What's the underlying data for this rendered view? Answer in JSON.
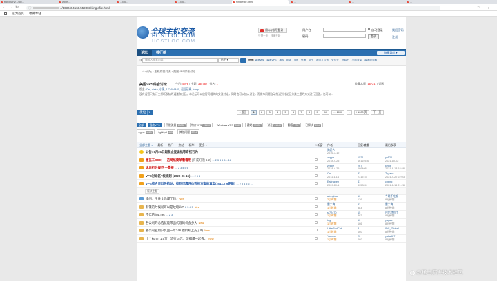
{
  "browser": {
    "tabs": [
      {
        "label": "thirdparty.../loc..."
      },
      {
        "label": "Apps..."
      },
      {
        "label": "...loc..."
      },
      {
        "label": "...loc..."
      },
      {
        "label": "singlefile.html"
      },
      {
        "label": "..."
      },
      {
        "label": "..."
      },
      {
        "label": "..."
      }
    ],
    "url_suffix": "../1632494168.552303/singlefile.html",
    "bookmarks": [
      "设为首页",
      "收藏本站"
    ]
  },
  "site": {
    "logo_cn": "全球主机交流",
    "logo_en": "HOSTLOC.COM",
    "qq_login": "用QQ帐号登录",
    "qq_sub": "只需一步，快速开始",
    "login": {
      "user_label": "用户名",
      "pass_label": "密码",
      "remember": "自动登录",
      "forgot": "找回密码",
      "login_btn": "登录",
      "register": "注册"
    },
    "nav": [
      {
        "label": "论坛"
      },
      {
        "label": "排行榜"
      }
    ],
    "quick_nav": "快捷导航 ▾",
    "search": {
      "placeholder": "请输入搜索内容",
      "scope": "帖子 ▾",
      "hot_label": "热搜:",
      "hot": [
        "香港vps",
        "香港VPS",
        "aws",
        "机场",
        "vps",
        "分销",
        "VPS",
        "搬瓦工公司",
        "火车头",
        "近似石",
        "不限流量",
        "香港服务器"
      ]
    },
    "breadcrumb": "⌂  ›  论坛  ›  主机综合交流  ›  美国VPS综合讨论"
  },
  "forum": {
    "title": "美国VPS综合讨论",
    "stats": [
      "今日:",
      "5976",
      "|",
      "主题:",
      "785782",
      "|",
      "排名:",
      "1"
    ],
    "favorite": "收藏本版 (",
    "favorite_count": "16721",
    "favorite_end": ")",
    "subscribe": "订阅",
    "moderators_label": "版主:",
    "moderators": "Cat, claire, 小黑, 177404A05, 逗逗莅棒, tomp",
    "rule": "没有运营只有订主打断发帖的通道和社区。本论坛可以放官司相关的交流讨论，同时也可以加入讨论，而发布问题自动推送到讨论区分类主题的方式进行回答，也可以..."
  },
  "pager": {
    "publish": "发帖",
    "prev": "< 返回",
    "pages": [
      "1",
      "2",
      "3",
      "4",
      "5",
      "6",
      "7",
      "8",
      "9",
      "10",
      "... 1000",
      "›",
      "/ 1000 页",
      "下一页"
    ]
  },
  "tags": [
    {
      "label": "全部",
      "count": "",
      "on": true
    },
    {
      "label": "温故VPS",
      "count": "",
      "on": true
    },
    {
      "label": "不限流量",
      "count": "18082"
    },
    {
      "label": "特价VPS",
      "count": "21150"
    },
    {
      "label": "Windows VPS",
      "count": "2285"
    },
    {
      "label": "建站",
      "count": "39392"
    },
    {
      "label": "讨论",
      "count": "41548"
    },
    {
      "label": "翻墙",
      "count": "292"
    },
    {
      "label": "已解决",
      "count": "3016"
    },
    {
      "label": "eginx",
      "count": "1923"
    },
    {
      "label": "lighttpd",
      "count": "465"
    },
    {
      "label": "其他问题",
      "count": "2754"
    }
  ],
  "list_header": {
    "filters": [
      "全部主题 ▾",
      "最新",
      "热门",
      "热帖",
      "精华",
      "更多 ▾"
    ],
    "flag": "□ 新窗",
    "author": "作者",
    "replies": "回复/查看",
    "last": "最后发表"
  },
  "threads": [
    {
      "icon": "ann",
      "title": "公告: 6月21日起禁止复读机等奇怪行为",
      "style": "bold",
      "extra": "",
      "pages": "",
      "new": "",
      "author": "狗是人",
      "a_date": "2016-7-12",
      "replies": "",
      "views": "",
      "last": "",
      "l_date": ""
    },
    {
      "icon": "pin",
      "title": "搬瓦工DC9：—这网络简单看看用",
      "style": "red",
      "extra": "[有成灯泡 1 2]",
      "pages": "... 2 3 4 5 6 ...16",
      "new": "",
      "author": "zvppe",
      "a_date": "2018-4-25",
      "replies": "1521",
      "views": "16114936",
      "last": "yy520",
      "l_date": "2021-10-22"
    },
    {
      "icon": "pin",
      "title": "论坛行为规范 一票拒",
      "style": "red",
      "extra": "",
      "pages": "... 2 3 4 5 6",
      "new": "",
      "author": "zvppe",
      "a_date": "2018-4-25",
      "replies": "267",
      "views": "666408",
      "last": "kepie",
      "l_date": "2021-9-18 18:58"
    },
    {
      "icon": "pin",
      "title": "VPS讨论区T板规则 (2020-06-16)",
      "style": "bold",
      "extra": "",
      "pages": "... 2 3 4",
      "new": "",
      "author": "Cat",
      "a_date": "2011-1-14",
      "replies": "32",
      "views": "231573",
      "last": "Trylane",
      "l_date": "2021-4-22 22:03"
    },
    {
      "icon": "pin",
      "title": "VPS综合资料导航站，找到可靠评估选择方案的真实(2011.7.9更新)",
      "style": "blue",
      "extra": "",
      "pages": "... 2 3 4 5 6 ...",
      "new": "",
      "author": "Eailrraven",
      "a_date": "2009-10-1",
      "replies": "41",
      "views": "305824",
      "last": "chenq",
      "l_date": "2021-1-14 21:28"
    },
    {
      "icon": "sep",
      "title": "版块主题",
      "style": "",
      "extra": "",
      "pages": "",
      "new": "",
      "author": "",
      "a_date": "",
      "replies": "",
      "views": "",
      "last": "",
      "l_date": ""
    },
    {
      "icon": "ln",
      "title": "提问：甲骨文你爆了吗?",
      "style": "",
      "extra": "",
      "pages": "",
      "new": "New",
      "author": "afengbao",
      "a_date": "2小时前",
      "replies": "10",
      "views": "126",
      "last": "今晚不吃饭",
      "l_date": "8分钟前"
    },
    {
      "icon": "folder",
      "title": "有钱的时候就可以是垃圾么?",
      "style": "",
      "extra": "",
      "pages": "2 3 4 5",
      "new": "New",
      "author": "雷丁海",
      "a_date": "1小时前",
      "replies": "33",
      "views": "383",
      "last": "雷丁海",
      "l_date": "8分钟前"
    },
    {
      "icon": "folder",
      "title": "不仁的 ipp.net",
      "style": "",
      "extra": "",
      "pages": "... 2 3",
      "new": "",
      "author": "st72470",
      "a_date": "1小时前",
      "replies": "15",
      "views": "362",
      "last": "巴比特拉丁",
      "l_date": "8分钟前"
    },
    {
      "icon": "folder",
      "title": "各公司的总选就能带出代理的机会多大",
      "style": "",
      "extra": "",
      "pages": "",
      "new": "New",
      "author": "tdg",
      "a_date": "1小时前",
      "replies": "10",
      "views": "166",
      "last": "yagaa",
      "l_date": "8分钟前"
    },
    {
      "icon": "folder",
      "title": "各公司业用户负面一年246 也价却上支了吗",
      "style": "",
      "extra": "",
      "pages": "",
      "new": "New",
      "author": "LittleRedCat",
      "a_date": "1小时前",
      "replies": "8",
      "views": "160",
      "last": "IDC_Global",
      "l_date": "8分钟前"
    },
    {
      "icon": "folder",
      "title": "出个kurun 1.5万，流行15元，流都爆一起去。",
      "style": "",
      "extra": "",
      "pages": "",
      "new": "New",
      "author": "Yacoon",
      "a_date": "1小时前",
      "replies": "20",
      "views": "260",
      "last": "yaka527",
      "l_date": "8分钟前"
    }
  ],
  "watermark": "@稀土掘金技术社区"
}
